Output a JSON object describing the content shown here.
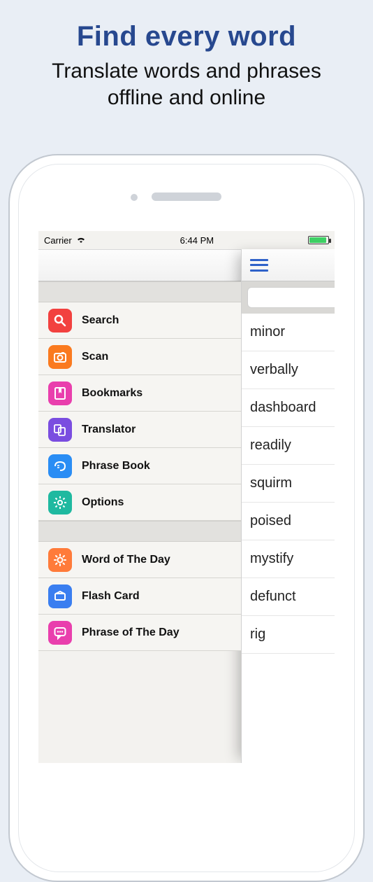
{
  "hero": {
    "title": "Find every word",
    "subtitle_line1": "Translate words and phrases",
    "subtitle_line2": "offline and online"
  },
  "statusbar": {
    "carrier": "Carrier",
    "time": "6:44 PM"
  },
  "menu": {
    "section1": [
      {
        "label": "Search",
        "icon": "search-icon",
        "color": "bg-red"
      },
      {
        "label": "Scan",
        "icon": "camera-icon",
        "color": "bg-orange"
      },
      {
        "label": "Bookmarks",
        "icon": "bookmark-icon",
        "color": "bg-mag"
      },
      {
        "label": "Translator",
        "icon": "translator-icon",
        "color": "bg-purple"
      },
      {
        "label": "Phrase Book",
        "icon": "phrase-icon",
        "color": "bg-blue"
      },
      {
        "label": "Options",
        "icon": "gear-icon",
        "color": "bg-teal"
      }
    ],
    "section2": [
      {
        "label": "Word of The Day",
        "icon": "sun-icon",
        "color": "bg-oran2"
      },
      {
        "label": "Flash Card",
        "icon": "card-icon",
        "color": "bg-blue2"
      },
      {
        "label": "Phrase of The Day",
        "icon": "chat-icon",
        "color": "bg-mag2"
      }
    ]
  },
  "words": [
    "minor",
    "verbally",
    "dashboard",
    "readily",
    "squirm",
    "poised",
    "mystify",
    "defunct",
    "rig"
  ]
}
